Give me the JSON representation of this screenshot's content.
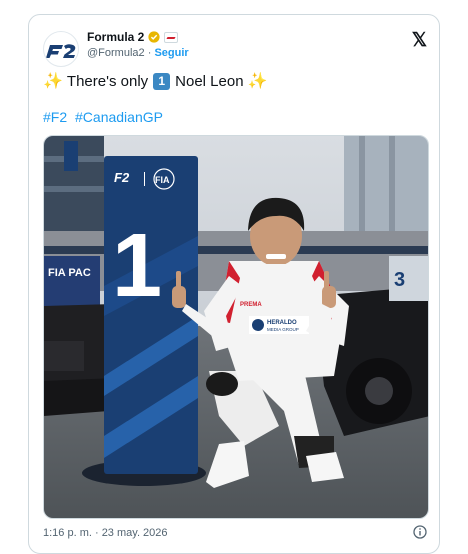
{
  "account": {
    "display_name": "Formula 2",
    "handle": "@Formula2",
    "separator": "·",
    "follow_label": "Seguir",
    "logo_text": "F2"
  },
  "tweet": {
    "text_before": "There's only",
    "keycap": "1",
    "text_after": "Noel Leon",
    "emoji": "✨",
    "hashtags": [
      "#F2",
      "#CanadianGP"
    ],
    "timestamp": "1:16 p. m. · 23 may. 2026"
  },
  "photo": {
    "board_logo": "F2",
    "board_fia": "FIA",
    "board_number": "1",
    "sponsor_suit": "HERALDO",
    "sponsor_suit_sub": "MEDIA GROUP",
    "sponsor_sleeve": "PREMA",
    "car_number": "3",
    "wall_text": "FIA PAC"
  },
  "colors": {
    "link": "#1d9bf0",
    "brand_blue": "#1a3f73",
    "suit_white": "#f4f4f4",
    "suit_red": "#d1202f"
  },
  "icons": {
    "close": "x-logo-icon",
    "verified": "verified-badge-icon",
    "info": "info-icon"
  }
}
